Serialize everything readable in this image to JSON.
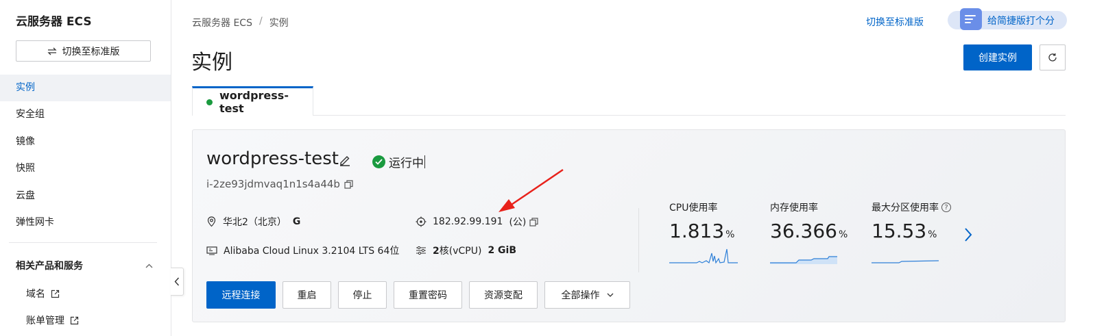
{
  "sidebar": {
    "title": "云服务器 ECS",
    "switch_label": "切换至标准版",
    "items": [
      {
        "label": "实例",
        "active": true
      },
      {
        "label": "安全组"
      },
      {
        "label": "镜像"
      },
      {
        "label": "快照"
      },
      {
        "label": "云盘"
      },
      {
        "label": "弹性网卡"
      }
    ],
    "group_title": "相关产品和服务",
    "links": [
      {
        "label": "域名"
      },
      {
        "label": "账单管理"
      }
    ]
  },
  "header": {
    "breadcrumb": [
      "云服务器 ECS",
      "实例"
    ],
    "breadcrumb_sep": "/",
    "switch_link": "切换至标准版",
    "feedback_label": "给简捷版打个分",
    "page_title": "实例",
    "create_label": "创建实例"
  },
  "tab": {
    "label": "wordpress-test"
  },
  "instance": {
    "name": "wordpress-test",
    "status": "运行中",
    "id": "i-2ze93jdmvaq1n1s4a44b",
    "region": "华北2（北京）",
    "zone": "G",
    "ip": "182.92.99.191",
    "ip_type": "(公)",
    "os": "Alibaba Cloud Linux 3.2104 LTS 64位",
    "cpu_cores": "2",
    "cpu_unit": "核(vCPU)",
    "memory": "2 GiB"
  },
  "actions": {
    "remote": "远程连接",
    "restart": "重启",
    "stop": "停止",
    "reset_pwd": "重置密码",
    "resize": "资源变配",
    "all_ops": "全部操作"
  },
  "metrics": [
    {
      "label": "CPU使用率",
      "value": "1.813",
      "unit": "%"
    },
    {
      "label": "内存使用率",
      "value": "36.366",
      "unit": "%"
    },
    {
      "label": "最大分区使用率",
      "value": "15.53",
      "unit": "%"
    }
  ],
  "colors": {
    "primary": "#0064c8",
    "success": "#1a9a3f",
    "annotation": "#e8221b"
  }
}
